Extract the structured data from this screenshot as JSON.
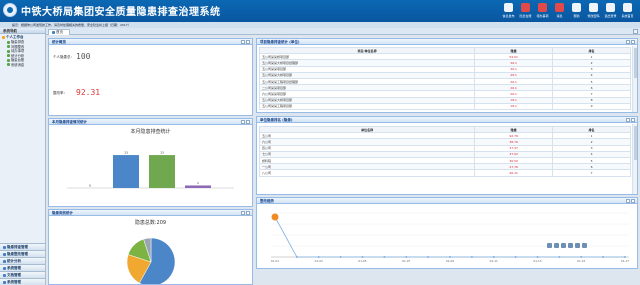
{
  "app": {
    "title": "中铁大桥局集团安全质量隐患排查治理系统",
    "notice": "提示：根据你公司发现的工作，请及时处理相关的质量、安全隐患并上报（日期：2017）"
  },
  "top_nav": [
    {
      "label": "信息发布",
      "icon": "info-icon",
      "alert": false
    },
    {
      "label": "隐患台账",
      "icon": "ledger-icon",
      "alert": true
    },
    {
      "label": "待办事项",
      "icon": "todo-icon",
      "alert": true
    },
    {
      "label": "消息",
      "icon": "message-icon",
      "alert": true
    },
    {
      "label": "帮助",
      "icon": "help-icon",
      "alert": false
    },
    {
      "label": "修改密码",
      "icon": "key-icon",
      "alert": false
    },
    {
      "label": "退出登录",
      "icon": "logout-icon",
      "alert": false
    },
    {
      "label": "系统首页",
      "icon": "home-icon",
      "alert": false
    }
  ],
  "sidebar": {
    "title": "系统导航",
    "group": "个人工作台",
    "items": [
      "隐患排查",
      "问题整改",
      "待办事项",
      "统计分析",
      "隐患台账",
      "系统消息"
    ],
    "accordions": [
      "隐患排查管理",
      "隐患整改管理",
      "统计分析",
      "系统管理",
      "文档管理",
      "系统管理"
    ]
  },
  "tabs": {
    "active": "首页"
  },
  "stats_panel": {
    "title": "统计概览",
    "row1_label": "个人隐患总：",
    "row1_value": "100",
    "row2_label": "整改率：",
    "row2_value": "92.31"
  },
  "bar_panel": {
    "title": "本月隐患排查情况统计",
    "chart_title": "本月隐患排查统计"
  },
  "pie_panel": {
    "title": "隐患类别统计",
    "chart_title": "隐患总数:209"
  },
  "colors": {
    "bar_blue": "#4a86c8",
    "bar_green": "#6fa84e",
    "bar_purple": "#8d6ab8",
    "pie_blue": "#4a86c8",
    "pie_orange": "#f0a830",
    "pie_green": "#7cb342",
    "pie_gray": "#9aa5b1",
    "trend_line": "#7fb0e0",
    "trend_marker": "#f08a24"
  },
  "chart_data": [
    {
      "type": "bar",
      "title": "本月隐患排查统计",
      "categories": [
        "",
        "",
        "",
        ""
      ],
      "values": [
        0,
        13,
        13,
        1
      ],
      "data_labels": [
        "0",
        "13",
        "13",
        "1"
      ],
      "ylim": [
        0,
        15
      ],
      "grid": false
    },
    {
      "type": "pie",
      "title": "隐患总数:209",
      "slices": [
        {
          "label": "",
          "value": 58
        },
        {
          "label": "",
          "value": 22
        },
        {
          "label": "",
          "value": 15
        },
        {
          "label": "",
          "value": 5
        }
      ]
    },
    {
      "type": "line",
      "title": "",
      "legend": [
        "",
        ""
      ],
      "x": [
        "01-01",
        "01-02",
        "01-03",
        "01-04",
        "01-05",
        "01-06",
        "01-07",
        "01-08",
        "01-09",
        "01-10",
        "01-11",
        "01-12",
        "01-13",
        "01-14",
        "01-15",
        "01-16",
        "01-17"
      ],
      "series": [
        {
          "values": [
            100,
            0,
            0,
            0,
            0,
            0,
            0,
            0,
            0,
            0,
            0,
            0,
            0,
            0,
            0,
            0,
            0
          ]
        }
      ],
      "ylim": [
        0,
        110
      ],
      "grid": true
    }
  ],
  "top_table": {
    "title": "项目隐患排查统计 (单位)",
    "headers": [
      "项目/单位名称",
      "隐患",
      "排名"
    ],
    "rows": [
      [
        "五公司某某桥项目部",
        "54.01",
        "1"
      ],
      [
        "五公司某某大桥项目经理部",
        "36.1",
        "2"
      ],
      [
        "五公司某某项目部",
        "36.1",
        "3"
      ],
      [
        "五公司某某大桥项目部",
        "28.1",
        "4"
      ],
      [
        "五公司某某工程项目经理部",
        "26.1",
        "5"
      ],
      [
        "二公司某某项目部",
        "26.1",
        "6"
      ],
      [
        "六公司某某项目部",
        "26.1",
        "7"
      ],
      [
        "五公司某某大桥项目部",
        "18.1",
        "8"
      ],
      [
        "五公司某某工程项目部",
        "18.1",
        "9"
      ]
    ]
  },
  "unit_table": {
    "title": "单位隐患排名 (隐患)",
    "headers": [
      "单位名称",
      "隐患",
      "排名"
    ],
    "rows": [
      [
        "五公司",
        "92.76",
        "1"
      ],
      [
        "六公司",
        "38.79",
        "2"
      ],
      [
        "四公司",
        "37.37",
        "3"
      ],
      [
        "七公司",
        "37.02",
        "4"
      ],
      [
        "桥科院",
        "36.50",
        "5"
      ],
      [
        "一公司",
        "27.76",
        "6"
      ],
      [
        "八公司",
        "26.11",
        "7"
      ]
    ]
  },
  "trend_panel": {
    "title": "整改趋势"
  }
}
